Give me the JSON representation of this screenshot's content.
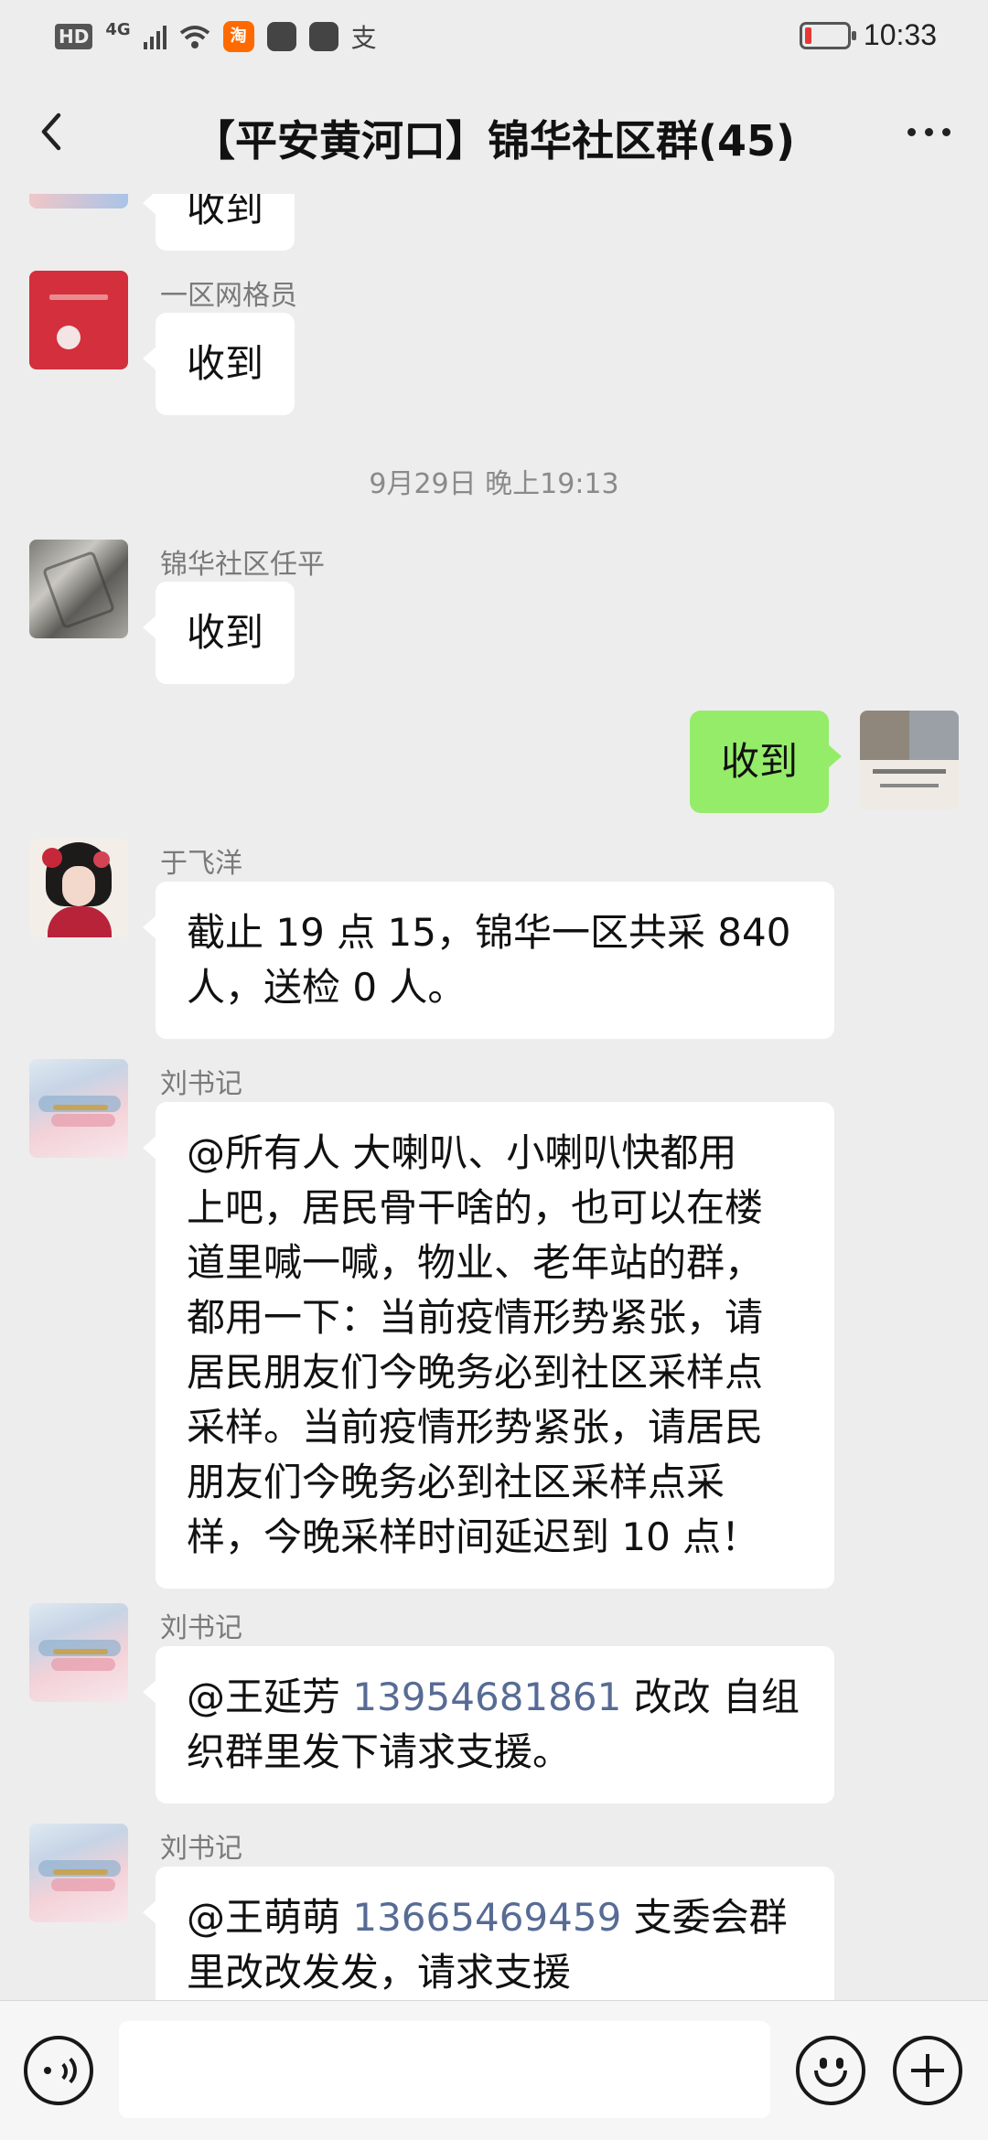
{
  "status_bar": {
    "hd": "HD",
    "network": "4G",
    "taobao_badge": "淘",
    "alipay_glyph": "支",
    "time": "10:33",
    "battery_level": 0.15
  },
  "header": {
    "title": "【平安黄河口】锦华社区群(45)"
  },
  "messages": {
    "m0": {
      "text": "收到"
    },
    "m1": {
      "sender": "一区网格员",
      "text": "收到"
    },
    "timestamp": "9月29日 晚上19:13",
    "m2": {
      "sender": "锦华社区任平",
      "text": "收到"
    },
    "m3": {
      "text": "收到"
    },
    "m4": {
      "sender": "于飞洋",
      "line1": "截止 19 点 15，锦华一区共采 840",
      "line2": "人，送检 0 人。"
    },
    "m5": {
      "sender": "刘书记",
      "line1": "@所有人  大喇叭、小喇叭快都用",
      "line2": "上吧，居民骨干啥的，也可以在楼",
      "line3": "道里喊一喊，物业、老年站的群，",
      "line4": "都用一下：当前疫情形势紧张，请",
      "line5": "居民朋友们今晚务必到社区采样点",
      "line6": "采样。当前疫情形势紧张，请居民",
      "line7": "朋友们今晚务必到社区采样点采",
      "line8": "样，今晚采样时间延迟到 10 点！"
    },
    "m6": {
      "sender": "刘书记",
      "mention": "@王延芳 ",
      "phone": "13954681861",
      "rest1": " 改改  自组",
      "line2": "织群里发下请求支援。"
    },
    "m7": {
      "sender": "刘书记",
      "mention": "@王萌萌 ",
      "phone": "13665469459",
      "rest1": "  支委会群",
      "line2": "里改改发发，请求支援"
    }
  },
  "input_bar": {
    "placeholder": ""
  },
  "colors": {
    "background": "#ededed",
    "my_bubble": "#95ec69",
    "their_bubble": "#ffffff",
    "phone_link": "#576b95",
    "sender_name": "#7a7a7a"
  },
  "icons": [
    "back-arrow-icon",
    "more-icon",
    "voice-icon",
    "emoji-icon",
    "plus-icon",
    "battery-icon",
    "signal-icon",
    "wifi-icon"
  ]
}
